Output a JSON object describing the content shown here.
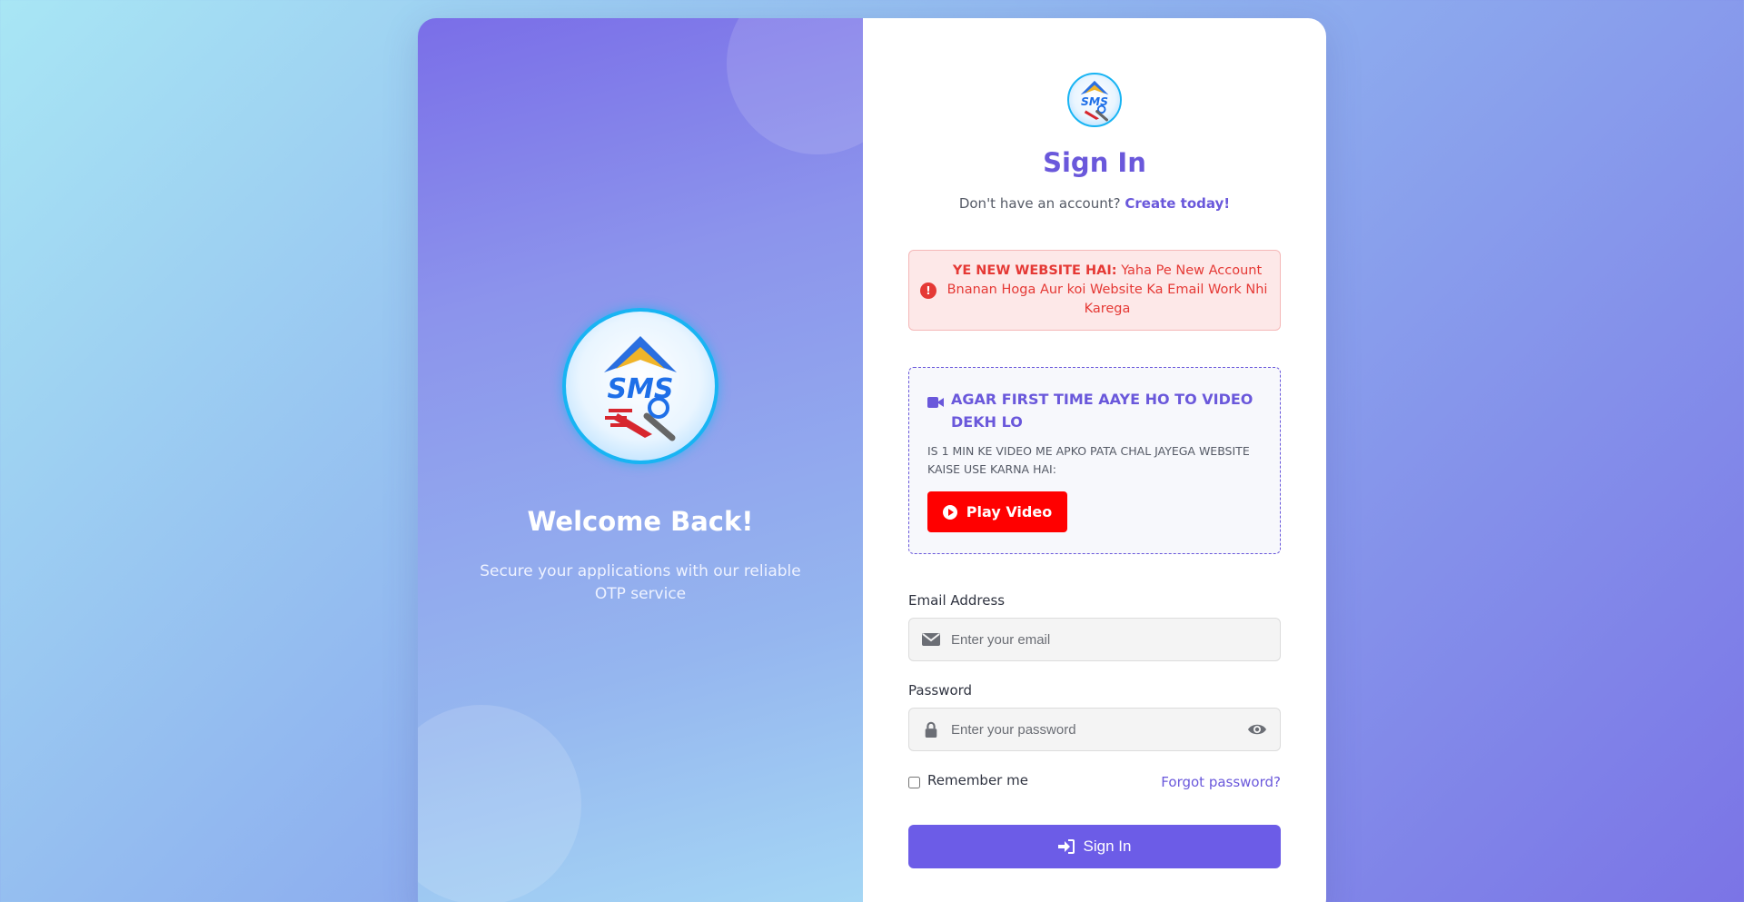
{
  "left_panel": {
    "logo_text": "SMS",
    "title": "Welcome Back!",
    "subtitle": "Secure your applications with our reliable OTP service"
  },
  "right_panel": {
    "logo_text": "SMS",
    "title": "Sign In",
    "account_prompt": "Don't have an account?",
    "create_link": "Create today!",
    "alert": {
      "strong": "YE NEW WEBSITE HAI:",
      "message": "Yaha Pe New Account Bnanan Hoga Aur koi Website Ka Email Work Nhi Karega",
      "icon": "exclamation-circle-icon"
    },
    "video": {
      "icon": "video-camera-icon",
      "title": "AGAR FIRST TIME AAYE HO TO VIDEO DEKH LO",
      "description": "IS 1 MIN KE VIDEO ME APKO PATA CHAL JAYEGA WEBSITE KAISE USE KARNA HAI:",
      "button_label": "Play Video",
      "button_icon": "play-circle-icon"
    },
    "form": {
      "email_label": "Email Address",
      "email_placeholder": "Enter your email",
      "email_value": "",
      "password_label": "Password",
      "password_placeholder": "Enter your password",
      "password_value": "",
      "remember_label": "Remember me",
      "remember_checked": false,
      "forgot_link": "Forgot password?",
      "submit_label": "Sign In"
    }
  },
  "colors": {
    "accent": "#6a58db",
    "button": "#6c5ce7",
    "play_button": "#ff0000",
    "alert_text": "#e53935",
    "alert_bg": "#fde8e8"
  }
}
